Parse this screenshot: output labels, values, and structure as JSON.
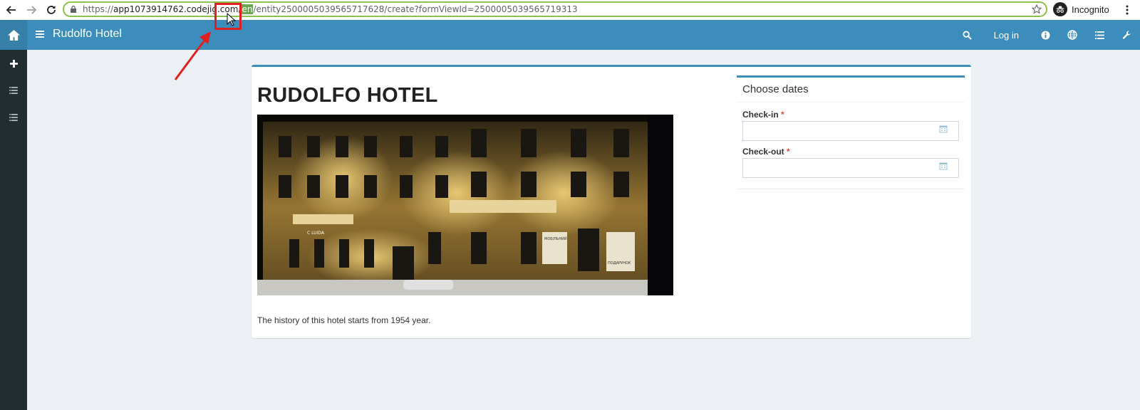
{
  "browser": {
    "url_pre": "https://",
    "url_host": "app1073914762.codejig.com",
    "url_sep": "/",
    "url_lang": "en",
    "url_rest": "/entity2500005039565717628/create?formViewId=2500005039565719313",
    "incognito_label": "Incognito"
  },
  "header": {
    "brand": "Rudolfo Hotel",
    "login_label": "Log in"
  },
  "main": {
    "hotel_title": "RUDOLFO HOTEL",
    "description": "The history of this hotel starts from 1954 year.",
    "image_signs": {
      "sign1": "С LUIDA",
      "sign2": "МОБІЛЬНИЙ",
      "sign3": "ПОДАРУНОК"
    }
  },
  "dates": {
    "title": "Choose dates",
    "checkin_label": "Check-in",
    "checkout_label": "Check-out",
    "required_mark": "*",
    "checkin_value": "",
    "checkout_value": ""
  },
  "colors": {
    "header_bg": "#3c8dbc",
    "sidebar_bg": "#222d32",
    "annotation": "#e02020",
    "url_highlight": "#6aa84f"
  }
}
